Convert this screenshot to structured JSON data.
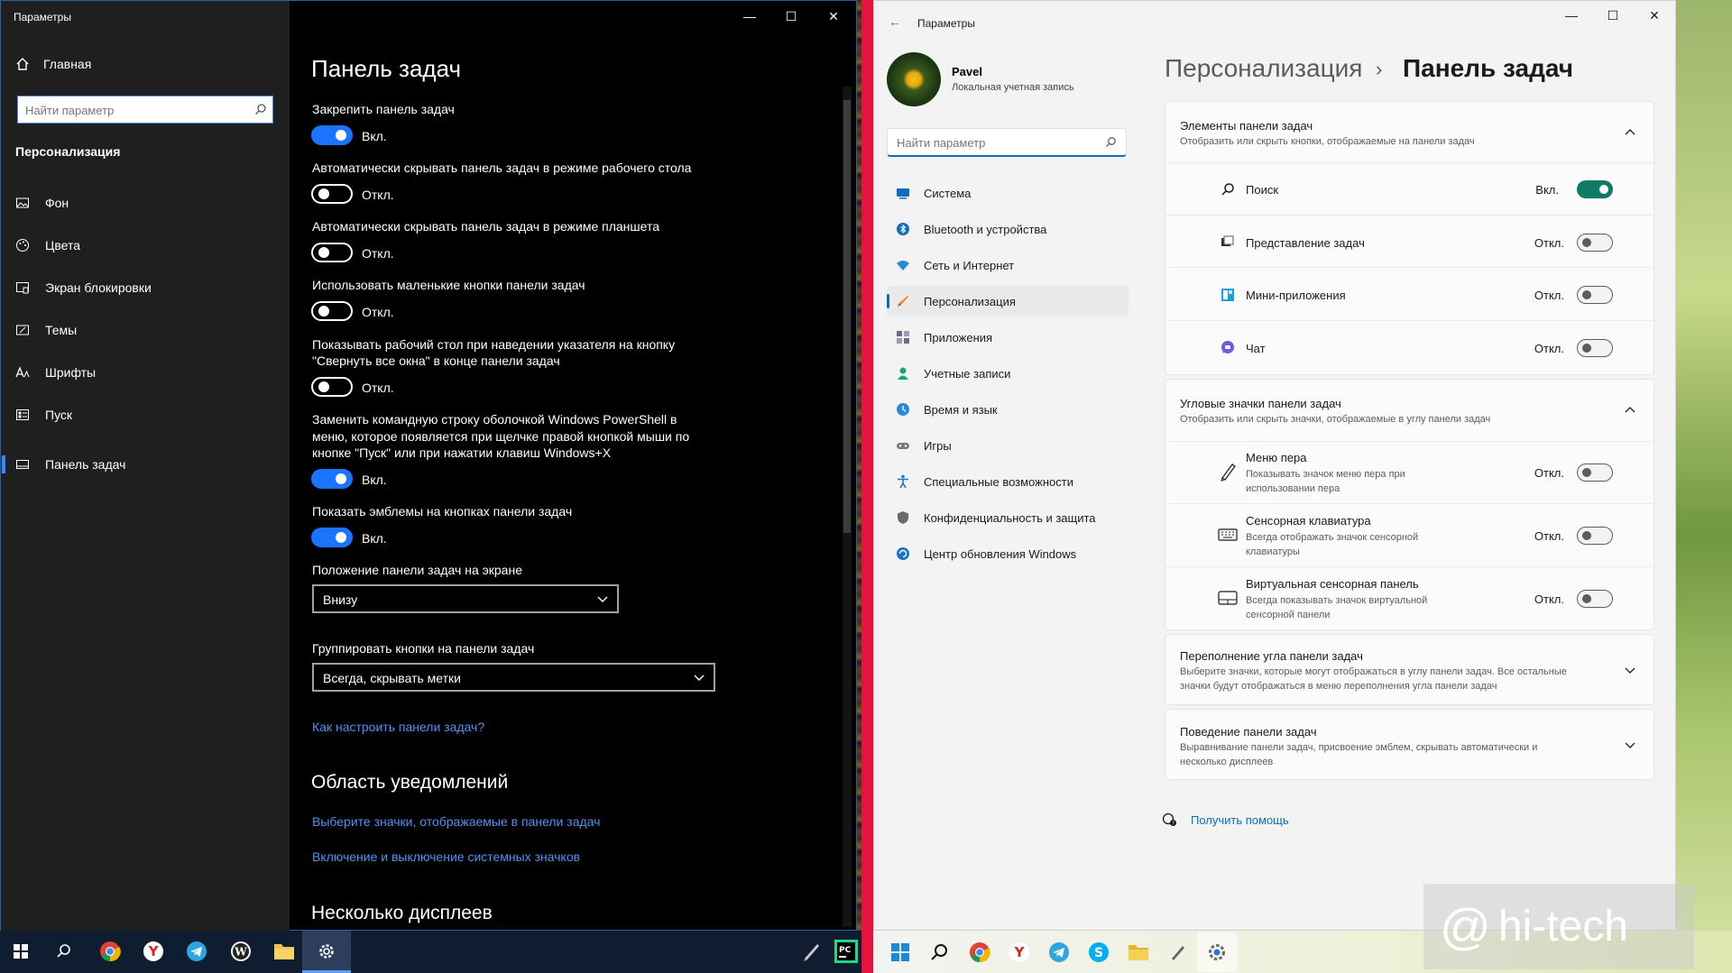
{
  "w10": {
    "window_title": "Параметры",
    "controls": {
      "minimize": "—",
      "maximize": "☐",
      "close": "✕"
    },
    "home_label": "Главная",
    "search_placeholder": "Найти параметр",
    "section_label": "Персонализация",
    "nav": [
      {
        "label": "Фон",
        "icon": "image-icon"
      },
      {
        "label": "Цвета",
        "icon": "palette-icon"
      },
      {
        "label": "Экран блокировки",
        "icon": "lock-screen-icon"
      },
      {
        "label": "Темы",
        "icon": "themes-icon"
      },
      {
        "label": "Шрифты",
        "icon": "fonts-icon"
      },
      {
        "label": "Пуск",
        "icon": "start-icon"
      },
      {
        "label": "Панель задач",
        "icon": "taskbar-icon",
        "active": true
      }
    ],
    "heading": "Панель задач",
    "settings": [
      {
        "label": "Закрепить панель задач",
        "state": "Вкл.",
        "on": true
      },
      {
        "label": "Автоматически скрывать панель задач в режиме рабочего стола",
        "state": "Откл.",
        "on": false
      },
      {
        "label": "Автоматически скрывать панель задач в режиме планшета",
        "state": "Откл.",
        "on": false
      },
      {
        "label": "Использовать маленькие кнопки панели задач",
        "state": "Откл.",
        "on": false
      },
      {
        "label_line1": "Показывать рабочий стол при наведении указателя на кнопку",
        "label_line2": "\"Свернуть все окна\" в конце панели задач",
        "state": "Откл.",
        "on": false
      },
      {
        "label_line1": "Заменить командную строку оболочкой Windows PowerShell в",
        "label_line2": "меню, которое появляется при щелчке правой кнопкой мыши по",
        "label_line3": "кнопке \"Пуск\" или при нажатии клавиш Windows+X",
        "state": "Вкл.",
        "on": true
      },
      {
        "label": "Показать эмблемы на кнопках панели задач",
        "state": "Вкл.",
        "on": true
      }
    ],
    "position_label": "Положение панели задач на экране",
    "position_value": "Внизу",
    "group_label": "Группировать кнопки на панели задач",
    "group_value": "Всегда, скрывать метки",
    "help_link": "Как настроить панели задач?",
    "notif_heading": "Область уведомлений",
    "notif_link1": "Выберите значки, отображаемые в панели задач",
    "notif_link2": "Включение и выключение системных значков",
    "multi_heading": "Несколько дисплеев"
  },
  "w11": {
    "window_title": "Параметры",
    "back_icon": "←",
    "controls": {
      "minimize": "—",
      "maximize": "☐",
      "close": "✕"
    },
    "user_name": "Pavel",
    "account_type": "Локальная учетная запись",
    "search_placeholder": "Найти параметр",
    "nav": [
      {
        "label": "Система",
        "icon": "system-icon",
        "color": "#0f6cbd"
      },
      {
        "label": "Bluetooth и устройства",
        "icon": "bluetooth-icon",
        "color": "#0f6cbd"
      },
      {
        "label": "Сеть и Интернет",
        "icon": "network-icon",
        "color": "#2a8ad4"
      },
      {
        "label": "Персонализация",
        "icon": "brush-icon",
        "color": "#e8891c",
        "active": true
      },
      {
        "label": "Приложения",
        "icon": "apps-icon",
        "color": "#6b6b8a"
      },
      {
        "label": "Учетные записи",
        "icon": "accounts-icon",
        "color": "#1aa37a"
      },
      {
        "label": "Время и язык",
        "icon": "time-language-icon",
        "color": "#2a8ad4"
      },
      {
        "label": "Игры",
        "icon": "gaming-icon",
        "color": "#7a7a7a"
      },
      {
        "label": "Специальные возможности",
        "icon": "accessibility-icon",
        "color": "#1a73c8"
      },
      {
        "label": "Конфиденциальность и защита",
        "icon": "shield-icon",
        "color": "#6b6b6b"
      },
      {
        "label": "Центр обновления Windows",
        "icon": "update-icon",
        "color": "#1a73c8"
      }
    ],
    "breadcrumb_parent": "Персонализация",
    "breadcrumb_sep": "›",
    "breadcrumb_current": "Панель задач",
    "items_card": {
      "title": "Элементы панели задач",
      "subtitle": "Отобразить или скрыть кнопки, отображаемые на панели задач",
      "rows": [
        {
          "label": "Поиск",
          "icon": "search-icon",
          "state": "Вкл.",
          "on": true
        },
        {
          "label": "Представление задач",
          "icon": "task-view-icon",
          "state": "Откл.",
          "on": false
        },
        {
          "label": "Мини-приложения",
          "icon": "widgets-icon",
          "state": "Откл.",
          "on": false
        },
        {
          "label": "Чат",
          "icon": "chat-icon",
          "state": "Откл.",
          "on": false
        }
      ]
    },
    "corner_card": {
      "title": "Угловые значки панели задач",
      "subtitle": "Отобразить или скрыть значки, отображаемые в углу панели задач",
      "rows": [
        {
          "label": "Меню пера",
          "sub1": "Показывать значок меню пера при",
          "sub2": "использовании пера",
          "icon": "pen-icon",
          "state": "Откл.",
          "on": false
        },
        {
          "label": "Сенсорная клавиатура",
          "sub1": "Всегда отображать значок сенсорной",
          "sub2": "клавиатуры",
          "icon": "keyboard-icon",
          "state": "Откл.",
          "on": false
        },
        {
          "label": "Виртуальная сенсорная панель",
          "sub1": "Всегда показывать значок виртуальной",
          "sub2": "сенсорной панели",
          "icon": "touchpad-icon",
          "state": "Откл.",
          "on": false
        }
      ]
    },
    "overflow_card": {
      "title": "Переполнение угла панели задач",
      "sub1": "Выберите значки, которые могут отображаться в углу панели задач. Все остальные",
      "sub2": "значки будут отображаться в меню переполнения угла панели задач"
    },
    "behavior_card": {
      "title": "Поведение панели задач",
      "sub1": "Выравнивание панели задач, присвоение эмблем, скрывать автоматически и",
      "sub2": "несколько дисплеев"
    },
    "help_link": "Получить помощь"
  },
  "taskbar10": [
    "windows-start-icon",
    "search-icon",
    "chrome-icon",
    "yandex-icon",
    "telegram-icon",
    "wordpress-icon",
    "file-explorer-icon",
    "settings-icon",
    "pen-icon",
    "pycharm-icon"
  ],
  "taskbar11": [
    "windows-start-icon",
    "search-icon",
    "chrome-icon",
    "yandex-icon",
    "telegram-icon",
    "skype-icon",
    "file-explorer-icon",
    "pen-icon",
    "settings-icon"
  ],
  "watermark": {
    "at": "@",
    "text": "hi-tech"
  },
  "colors": {
    "w10_accent": "#1a74ff",
    "w10_link": "#4a94f5",
    "w11_accent": "#0f6cbd",
    "w11_toggle_on": "#117a65",
    "separator": "#e8123c"
  }
}
